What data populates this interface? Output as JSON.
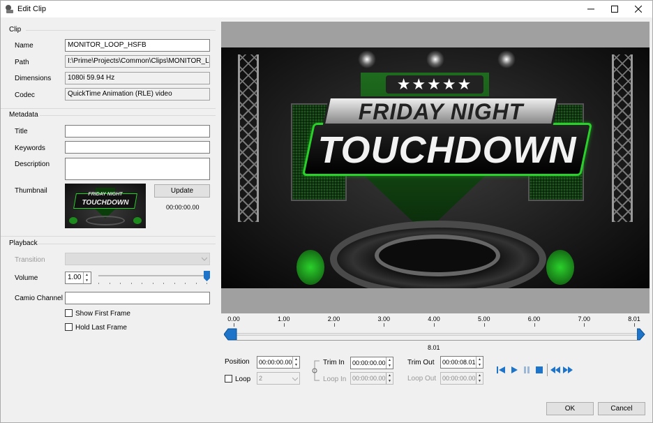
{
  "window": {
    "title": "Edit Clip"
  },
  "clip": {
    "section": "Clip",
    "name_label": "Name",
    "name_value": "MONITOR_LOOP_HSFB",
    "path_label": "Path",
    "path_value": "I:\\Prime\\Projects\\Common\\Clips\\MONITOR_LOOP_HSFB",
    "dimensions_label": "Dimensions",
    "dimensions_value": "1080i 59.94 Hz",
    "codec_label": "Codec",
    "codec_value": "QuickTime Animation (RLE) video"
  },
  "metadata": {
    "section": "Metadata",
    "title_label": "Title",
    "title_value": "",
    "keywords_label": "Keywords",
    "keywords_value": "",
    "description_label": "Description",
    "description_value": "",
    "thumbnail_label": "Thumbnail",
    "update_label": "Update",
    "thumbnail_time": "00:00:00.00"
  },
  "playback": {
    "section": "Playback",
    "transition_label": "Transition",
    "transition_value": "",
    "volume_label": "Volume",
    "volume_value": "1.00",
    "volume_level": 1.0,
    "camio_label": "Camio Channel",
    "camio_value": "",
    "show_first_frame": "Show First Frame",
    "hold_last_frame": "Hold Last Frame"
  },
  "preview": {
    "line1": "FRIDAY NIGHT",
    "line2": "TOUCHDOWN"
  },
  "timeline": {
    "ticks": [
      "0.00",
      "1.00",
      "2.00",
      "3.00",
      "4.00",
      "5.00",
      "6.00",
      "7.00",
      "8.01"
    ],
    "duration": "8.01",
    "position_fraction": 0.0
  },
  "transport": {
    "position_label": "Position",
    "position_value": "00:00:00.00",
    "loop_label": "Loop",
    "loop_count": "2",
    "trim_in_label": "Trim In",
    "trim_in_value": "00:00:00.00",
    "loop_in_label": "Loop In",
    "loop_in_value": "00:00:00.00",
    "trim_out_label": "Trim Out",
    "trim_out_value": "00:00:08.01",
    "loop_out_label": "Loop Out",
    "loop_out_value": "00:00:00.00"
  },
  "footer": {
    "ok_label": "OK",
    "cancel_label": "Cancel"
  },
  "colors": {
    "accent": "#1e74c8",
    "field_border": "#7a7a7a",
    "brand_green": "#2bd12b"
  }
}
